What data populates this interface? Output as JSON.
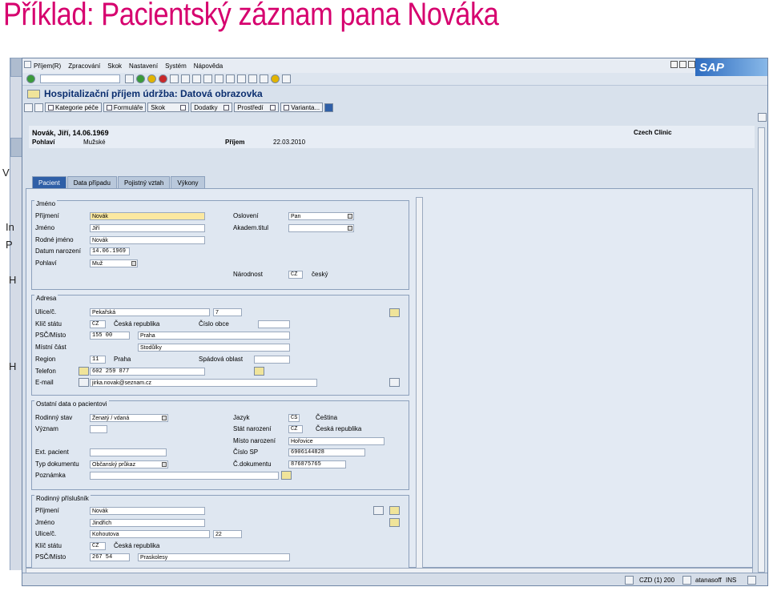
{
  "slide_title": "Příklad: Pacientský záznam pana Nováka",
  "background_window": {
    "labels": [
      "V",
      "In",
      "P",
      "H",
      "H"
    ]
  },
  "menu": [
    "Příjem(R)",
    "Zpracování",
    "Skok",
    "Nastavení",
    "Systém",
    "Nápověda"
  ],
  "logo": "SAP",
  "screen_title": "Hospitalizační příjem údržba: Datová obrazovka",
  "toolbar2": [
    "Kategorie péče",
    "Formuláře",
    "Skok",
    "Dodatky",
    "Prostředí",
    "Varianta..."
  ],
  "header": {
    "patient": "Novák, Jiří, 14.06.1969",
    "clinic": "Czech Clinic",
    "sex_label": "Pohlaví",
    "sex_value": "Mužské",
    "admission_label": "Příjem",
    "admission_value": "22.03.2010"
  },
  "tabs": [
    "Pacient",
    "Data případu",
    "Pojistný vztah",
    "Výkony"
  ],
  "name_group": {
    "title": "Jméno",
    "surname_label": "Příjmení",
    "surname": "Novák",
    "first_label": "Jméno",
    "first": "Jiří",
    "birthname_label": "Rodné jméno",
    "birthname": "Novák",
    "dob_label": "Datum narození",
    "dob": "14.06.1969",
    "sex_label": "Pohlaví",
    "sex": "Muž",
    "salutation_label": "Oslovení",
    "salutation": "Pan",
    "acad_label": "Akadem.titul",
    "acad": "",
    "nationality_label": "Národnost",
    "nationality_code": "CZ",
    "nationality": "český"
  },
  "address_group": {
    "title": "Adresa",
    "street_label": "Ulice/č.",
    "street": "Pekařská",
    "number": "7",
    "country_label": "Klíč státu",
    "country_code": "CZ",
    "country": "Česká republika",
    "municipality_no_label": "Číslo obce",
    "municipality_no": "",
    "zip_label": "PSČ/Místo",
    "zip": "155 00",
    "city": "Praha",
    "district_label": "Místní část",
    "district": "Stodůlky",
    "region_label": "Region",
    "region_code": "11",
    "region": "Praha",
    "catchment_label": "Spádová oblast",
    "catchment": "",
    "phone_label": "Telefon",
    "phone": "602 259 877",
    "email_label": "E-mail",
    "email": "jirka.novak@seznam.cz"
  },
  "other_group": {
    "title": "Ostatní data o pacientovi",
    "marital_label": "Rodinný stav",
    "marital": "Ženatý / vdaná",
    "significance_label": "Význam",
    "significance": "",
    "ext_label": "Ext. pacient",
    "ext": "",
    "doctype_label": "Typ dokumentu",
    "doctype": "Občanský průkaz",
    "note_label": "Poznámka",
    "note": "",
    "language_label": "Jazyk",
    "language_code": "CS",
    "language": "Čeština",
    "birthcountry_label": "Stát narození",
    "birthcountry_code": "CZ",
    "birthcountry": "Česká republika",
    "birthplace_label": "Místo narození",
    "birthplace": "Hořovice",
    "sp_label": "Číslo SP",
    "sp": "6906144828",
    "docno_label": "Č.dokumentu",
    "docno": "876875765"
  },
  "relative_group": {
    "title": "Rodinný příslušník",
    "surname_label": "Příjmení",
    "surname": "Novák",
    "first_label": "Jméno",
    "first": "Jindřich",
    "street_label": "Ulice/č.",
    "street": "Kohoutova",
    "number": "22",
    "country_label": "Klíč státu",
    "country_code": "CZ",
    "country": "Česká republika",
    "zip_label": "PSČ/Místo",
    "zip": "267 54",
    "city": "Praskolesy"
  },
  "status": {
    "system": "CZD (1) 200",
    "user": "atanasoff",
    "mode": "INS"
  }
}
